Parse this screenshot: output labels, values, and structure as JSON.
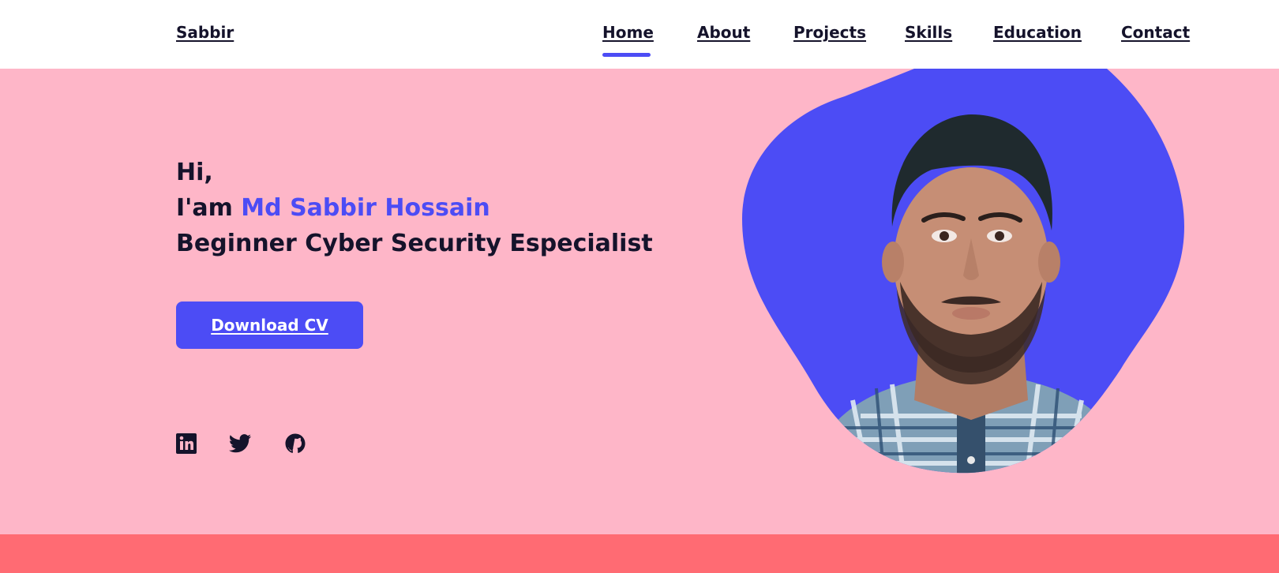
{
  "header": {
    "logo": "Sabbir",
    "nav": [
      {
        "label": "Home",
        "active": true
      },
      {
        "label": "About"
      },
      {
        "label": "Projects"
      },
      {
        "label": "Skills"
      },
      {
        "label": "Education"
      },
      {
        "label": "Contact"
      }
    ]
  },
  "hero": {
    "line1": "Hi,",
    "line2_prefix": "I'am ",
    "name": "Md Sabbir Hossain",
    "line3": "Beginner Cyber Security Especialist",
    "cta": "Download CV",
    "social": [
      {
        "icon": "linkedin-icon"
      },
      {
        "icon": "twitter-icon"
      },
      {
        "icon": "github-icon"
      }
    ],
    "photo_icon": "portrait-photo"
  },
  "colors": {
    "accent": "#4c4cf5",
    "hero_bg": "#feb6c8",
    "footer_band": "#ff6b73",
    "text": "#15132b"
  }
}
